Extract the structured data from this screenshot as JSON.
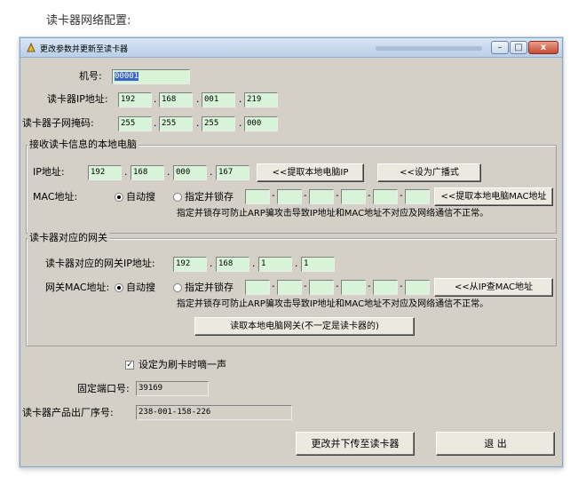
{
  "heading": "读卡器网络配置:",
  "window": {
    "title": "更改参数并更新至读卡器",
    "controls": {
      "minimize": "–",
      "maximize": "□",
      "close": "x"
    }
  },
  "machine": {
    "label": "机号:",
    "value": "00001"
  },
  "reader_ip": {
    "label": "读卡器IP地址:",
    "octets": [
      "192",
      "168",
      "001",
      "219"
    ]
  },
  "reader_mask": {
    "label": "读卡器子网掩码:",
    "octets": [
      "255",
      "255",
      "255",
      "000"
    ]
  },
  "local_pc": {
    "legend": "接收读卡信息的本地电脑",
    "ip_label": "IP地址:",
    "ip_octets": [
      "192",
      "168",
      "000",
      "167"
    ],
    "get_ip_button": "<<提取本地电脑IP",
    "broadcast_button": "<<设为广播式",
    "mac_label": "MAC地址:",
    "auto_label": "自动搜",
    "lock_label": "指定并锁存",
    "get_mac_button": "<<提取本地电脑MAC地址",
    "note": "指定并锁存可防止ARP骗攻击导致IP地址和MAC地址不对应及网络通信不正常。"
  },
  "gateway": {
    "legend": "读卡器对应的网关",
    "ip_label": "读卡器对应的网关IP地址:",
    "ip_octets": [
      "192",
      "168",
      "1",
      "1"
    ],
    "mac_label": "网关MAC地址:",
    "auto_label": "自动搜",
    "lock_label": "指定并锁存",
    "lookup_button": "<<从IP查MAC地址",
    "note": "指定并锁存可防止ARP骗攻击导致IP地址和MAC地址不对应及网络通信不正常。",
    "read_button": "读取本地电脑网关(不一定是读卡器的)"
  },
  "beep": {
    "label": "设定为刷卡时嘀一声",
    "check": "✓"
  },
  "port": {
    "label": "固定端口号:",
    "value": "39169"
  },
  "serial": {
    "label": "读卡器产品出厂序号:",
    "value": "238-001-158-226"
  },
  "buttons": {
    "update": "更改并下传至读卡器",
    "exit": "退  出"
  }
}
